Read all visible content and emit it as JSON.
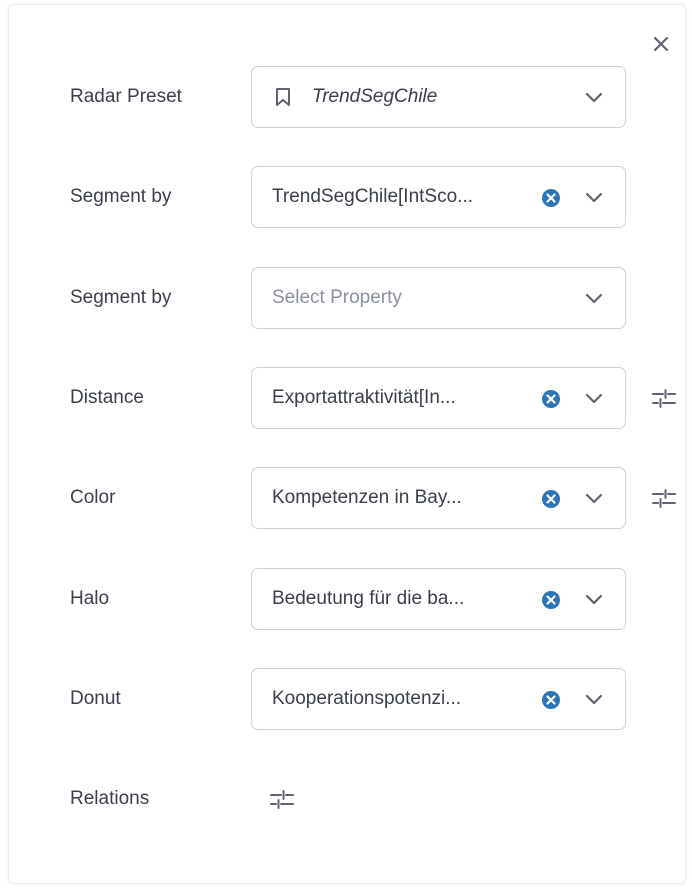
{
  "close_icon": "close-icon",
  "colors": {
    "text": "#3a3f4a",
    "placeholder": "#8a909c",
    "border": "#cdd1d9",
    "clear_icon": "#2e75b6",
    "icon_gray": "#5f6470"
  },
  "rows": {
    "radar_preset": {
      "label": "Radar Preset",
      "value": "TrendSegChile"
    },
    "segment_by_1": {
      "label": "Segment by",
      "value": "TrendSegChile[IntSco..."
    },
    "segment_by_2": {
      "label": "Segment by",
      "placeholder": "Select Property"
    },
    "distance": {
      "label": "Distance",
      "value": "Exportattraktivität[In..."
    },
    "color": {
      "label": "Color",
      "value": "Kompetenzen in Bay..."
    },
    "halo": {
      "label": "Halo",
      "value": "Bedeutung für die ba..."
    },
    "donut": {
      "label": "Donut",
      "value": "Kooperationspotenzi..."
    },
    "relations": {
      "label": "Relations"
    }
  }
}
